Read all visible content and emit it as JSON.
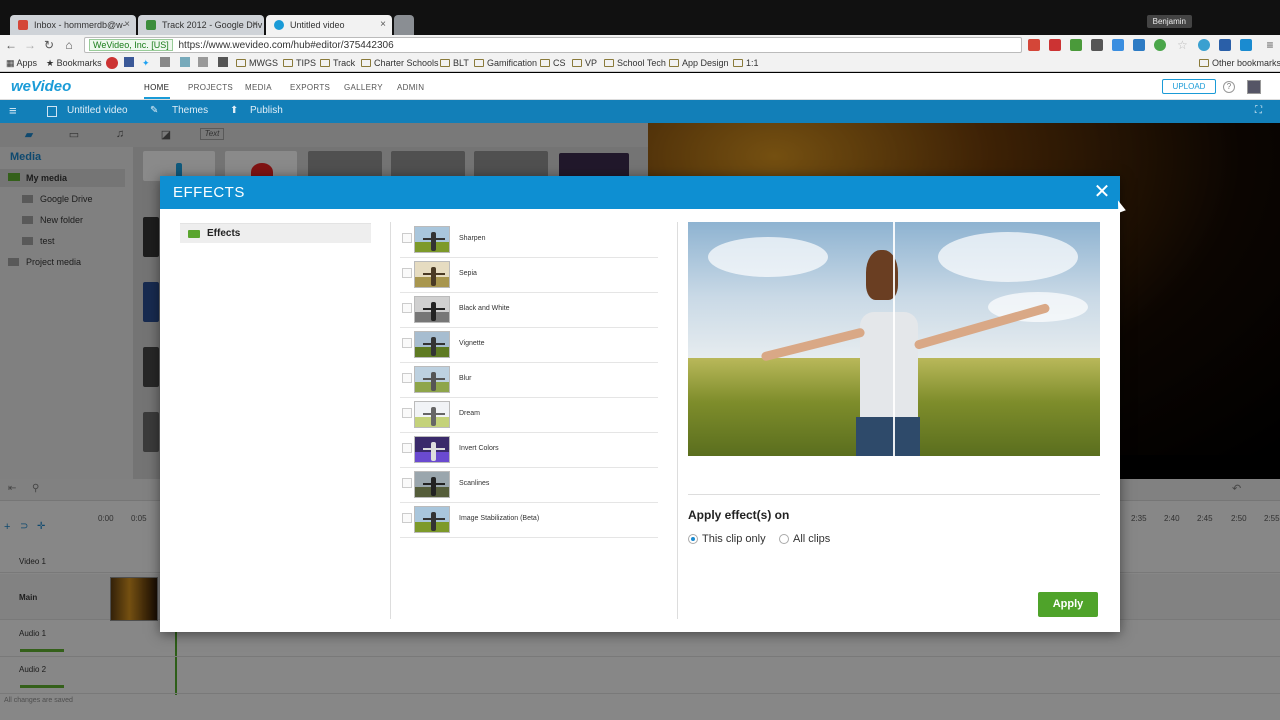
{
  "browser": {
    "tabs": [
      {
        "title": "Inbox - hommerdb@w-",
        "favicon_color": "#d44638",
        "active": false
      },
      {
        "title": "Track 2012 - Google Driv",
        "favicon_color": "#3c8d3c",
        "active": false
      },
      {
        "title": "Untitled video",
        "favicon_color": "#1a9bd7",
        "active": true
      }
    ],
    "profile_name": "Benjamin",
    "url_secure_label": "WeVideo, Inc. [US]",
    "url": "https://www.wevideo.com/hub#editor/375442306",
    "bookmarks": [
      {
        "label": "Apps",
        "icon": "apps-icon"
      },
      {
        "label": "Bookmarks",
        "icon": "star-icon"
      },
      {
        "label": "MWGS",
        "icon": "folder-icon"
      },
      {
        "label": "TIPS",
        "icon": "folder-icon"
      },
      {
        "label": "Track",
        "icon": "folder-icon"
      },
      {
        "label": "Charter Schools",
        "icon": "folder-icon"
      },
      {
        "label": "BLT",
        "icon": "folder-icon"
      },
      {
        "label": "Gamification",
        "icon": "folder-icon"
      },
      {
        "label": "CS",
        "icon": "folder-icon"
      },
      {
        "label": "VP",
        "icon": "folder-icon"
      },
      {
        "label": "School Tech",
        "icon": "folder-icon"
      },
      {
        "label": "App Design",
        "icon": "folder-icon"
      },
      {
        "label": "1:1",
        "icon": "folder-icon"
      }
    ],
    "other_bookmarks": "Other bookmarks"
  },
  "app": {
    "logo": "weVideo",
    "nav": [
      "HOME",
      "PROJECTS",
      "MEDIA",
      "EXPORTS",
      "GALLERY",
      "ADMIN"
    ],
    "upload_label": "UPLOAD",
    "project_title": "Untitled video",
    "themes_label": "Themes",
    "publish_label": "Publish",
    "text_tab_label": "Text",
    "media_heading": "Media",
    "media_tree": [
      "My media",
      "Google Drive",
      "New folder",
      "test",
      "Project media"
    ],
    "ruler_labels": [
      "0:00",
      "0:05",
      "2:35",
      "2:40",
      "2:45",
      "2:50",
      "2:55"
    ],
    "tracks": [
      "Video 1",
      "Main",
      "Audio 1",
      "Audio 2"
    ],
    "status": "All changes are saved"
  },
  "modal": {
    "title": "EFFECTS",
    "category": "Effects",
    "effects": [
      {
        "label": "Sharpen",
        "sky": "#a9c6dc",
        "grass": "#7d9a2a",
        "fig": "#333"
      },
      {
        "label": "Sepia",
        "sky": "#e6dcc1",
        "grass": "#a8964e",
        "fig": "#4a3a24"
      },
      {
        "label": "Black and White",
        "sky": "#d0d0d0",
        "grass": "#777777",
        "fig": "#222"
      },
      {
        "label": "Vignette",
        "sky": "#a7bdd0",
        "grass": "#5e7a22",
        "fig": "#333"
      },
      {
        "label": "Blur",
        "sky": "#bdd1e0",
        "grass": "#8ea54a",
        "fig": "#555"
      },
      {
        "label": "Dream",
        "sky": "#f1f3f6",
        "grass": "#c4d27a",
        "fig": "#666"
      },
      {
        "label": "Invert Colors",
        "sky": "#3a2a6a",
        "grass": "#6a4ad0",
        "fig": "#ddd"
      },
      {
        "label": "Scanlines",
        "sky": "#9aa6ad",
        "grass": "#555d3a",
        "fig": "#222"
      },
      {
        "label": "Image Stabilization (Beta)",
        "sky": "#a9c6dc",
        "grass": "#7d9a2a",
        "fig": "#333"
      }
    ],
    "apply_on_title": "Apply effect(s) on",
    "radio_this_clip": "This clip only",
    "radio_all_clips": "All clips",
    "selected_option": "This clip only",
    "apply_label": "Apply",
    "colors": {
      "header": "#0e8fd2",
      "apply": "#4fa32a"
    }
  }
}
